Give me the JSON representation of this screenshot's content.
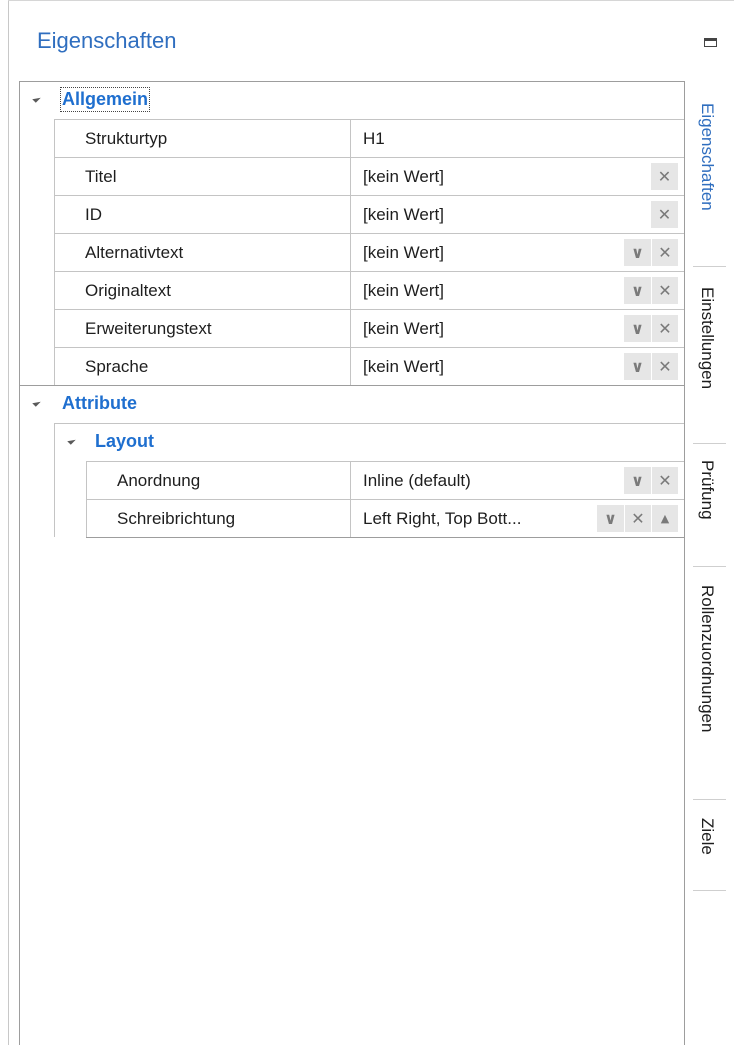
{
  "panel": {
    "title": "Eigenschaften"
  },
  "categories": {
    "general": "Allgemein",
    "attributes": "Attribute",
    "layout": "Layout"
  },
  "general_rows": [
    {
      "name": "Strukturtyp",
      "value": "H1"
    },
    {
      "name": "Titel",
      "value": "[kein Wert]"
    },
    {
      "name": "ID",
      "value": "[kein Wert]"
    },
    {
      "name": "Alternativtext",
      "value": "[kein Wert]"
    },
    {
      "name": "Originaltext",
      "value": "[kein Wert]"
    },
    {
      "name": "Erweiterungstext",
      "value": "[kein Wert]"
    },
    {
      "name": "Sprache",
      "value": "[kein Wert]"
    }
  ],
  "layout_rows": [
    {
      "name": "Anordnung",
      "value": "Inline (default)"
    },
    {
      "name": "Schreibrichtung",
      "value": "Left Right, Top Bott..."
    }
  ],
  "buttons": {
    "dropdown": "∨",
    "clear": "✕",
    "up": "▲"
  },
  "tabs": [
    "Eigenschaften",
    "Einstellungen",
    "Prüfung",
    "Rollenzuordnungen",
    "Ziele"
  ],
  "colors": {
    "accent": "#2f6ebf",
    "category": "#1f6fcf"
  }
}
